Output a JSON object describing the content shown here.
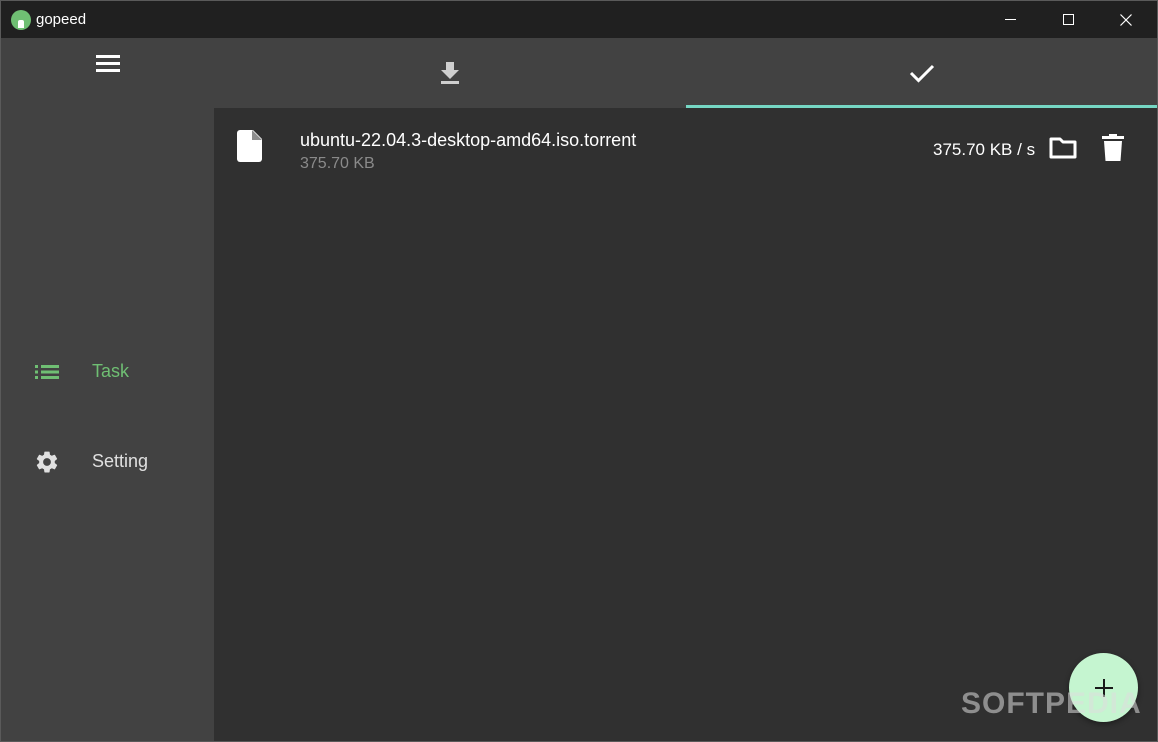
{
  "titlebar": {
    "title": "gopeed"
  },
  "sidebar": {
    "menu_icon": "menu-icon",
    "items": [
      {
        "label": "Task",
        "icon": "list-icon",
        "selected": true
      },
      {
        "label": "Setting",
        "icon": "gear-icon",
        "selected": false
      }
    ]
  },
  "tabs": [
    {
      "icon": "download-icon",
      "selected": false
    },
    {
      "icon": "check-icon",
      "selected": true
    }
  ],
  "tasks": [
    {
      "name": "ubuntu-22.04.3-desktop-amd64.iso.torrent",
      "size": "375.70 KB",
      "speed": "375.70 KB / s"
    }
  ],
  "fab": {
    "icon": "plus-icon"
  },
  "watermark": "SOFTPEDIA",
  "colors": {
    "accent": "#6fbf73",
    "tab_indicator": "#76d7c4",
    "fab": "#c5f5d0"
  }
}
